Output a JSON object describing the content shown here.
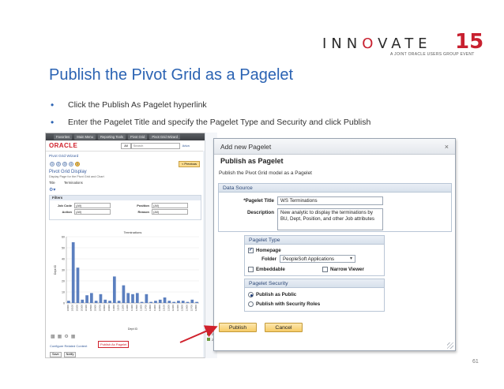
{
  "logo": {
    "word_left": "INN",
    "word_o": "O",
    "word_right": "VATE",
    "number": "15",
    "tagline": "A JOINT ORACLE USERS GROUP EVENT"
  },
  "slide": {
    "title": "Publish the Pivot Grid as a Pagelet",
    "bullets": [
      "Click the Publish As Pagelet hyperlink",
      "Enter the Pagelet Title and specify the Pagelet Type and Security and click Publish"
    ],
    "page_number": "61"
  },
  "left_screenshot": {
    "nav_items": [
      "Favorites",
      "Main Menu",
      "Reporting Tools",
      "Pivot Grid",
      "Pivot Grid Wizard"
    ],
    "oracle_logo": "ORACLE",
    "search_scope": "All",
    "search_placeholder": "Search",
    "advanced_link": "Adva",
    "wizard_title": "Pivot Grid Wizard",
    "steps": [
      "1",
      "2",
      "3",
      "4",
      "5"
    ],
    "previous_button": "< Previous",
    "display_title": "Pivot Grid Display",
    "display_subtitle": "Display Page for the Pivot Grid and Chart",
    "title_label": "Title",
    "title_value": "Terminations",
    "filters_label": "Filters",
    "filters": [
      {
        "label": "Job Code",
        "value": "(All)"
      },
      {
        "label": "Action",
        "value": "(All)"
      },
      {
        "label": "Position",
        "value": "(All)"
      },
      {
        "label": "Reason",
        "value": "(All)"
      }
    ],
    "configure_link": "Configure Related Content",
    "publish_pagelet_link": "Publish As Pagelet",
    "save_button": "Save",
    "notify_button": "Notify",
    "legend_items": [
      "270000",
      "270000"
    ]
  },
  "chart_data": {
    "type": "bar",
    "title": "Terminations",
    "xlabel": "Dept ID",
    "ylabel": "Dept ID",
    "ylim": [
      0,
      60
    ],
    "yticks": [
      0,
      10,
      20,
      30,
      40,
      50,
      60
    ],
    "categories": [
      "10000",
      "10100",
      "10200",
      "10300",
      "10400",
      "10500",
      "10600",
      "10700",
      "10800",
      "10900",
      "11000",
      "11100",
      "11200",
      "11300",
      "11400",
      "11500",
      "11600",
      "11700",
      "11800",
      "11900",
      "12000",
      "12100",
      "12200",
      "12300",
      "12400",
      "12500",
      "12600",
      "12700",
      "12800"
    ],
    "values": [
      2,
      55,
      32,
      3,
      7,
      9,
      2,
      8,
      3,
      2,
      24,
      2,
      16,
      9,
      8,
      9,
      1,
      8,
      1,
      2,
      3,
      5,
      2,
      1,
      2,
      2,
      1,
      3,
      1
    ],
    "color": "#5b7fbf",
    "grid": true
  },
  "dialog": {
    "title": "Add new Pagelet",
    "close_glyph": "×",
    "heading": "Publish as Pagelet",
    "description": "Publish the Pivot Grid model as a Pagelet",
    "data_source": {
      "header": "Data Source",
      "pagelet_title_label": "*Pagelet Title",
      "pagelet_title_value": "WS Terminations",
      "description_label": "Description",
      "description_value": "New analytic to display the terminations by BU, Dept, Position, and other Job attributes"
    },
    "pagelet_type": {
      "header": "Pagelet Type",
      "homepage_label": "Homepage",
      "homepage_checked": true,
      "folder_label": "Folder",
      "folder_value": "PeopleSoft Applications",
      "embeddable_label": "Embeddable",
      "embeddable_checked": false,
      "narrow_viewer_label": "Narrow Viewer",
      "narrow_viewer_checked": false
    },
    "pagelet_security": {
      "header": "Pagelet Security",
      "public_label": "Publish as Public",
      "public_selected": true,
      "roles_label": "Publish with Security Roles",
      "roles_selected": false
    },
    "publish_button": "Publish",
    "cancel_button": "Cancel"
  },
  "colors": {
    "title_blue": "#2b63b3",
    "brand_red": "#c8202f",
    "annotation_red": "#d0212c"
  }
}
